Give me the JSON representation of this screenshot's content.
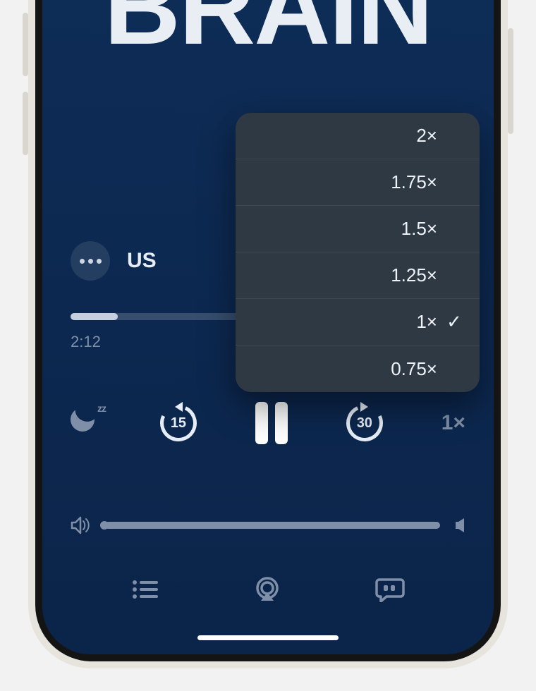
{
  "cover": {
    "title_text": "BRAIN"
  },
  "meta": {
    "more_button": "more",
    "episode_title_visible": "US"
  },
  "progress": {
    "elapsed_label": "2:12",
    "fill_percent": 12
  },
  "speed_menu": {
    "options": [
      {
        "label": "2×",
        "checked": false
      },
      {
        "label": "1.75×",
        "checked": false
      },
      {
        "label": "1.5×",
        "checked": false
      },
      {
        "label": "1.25×",
        "checked": false
      },
      {
        "label": "1×",
        "checked": true
      },
      {
        "label": "0.75×",
        "checked": false
      }
    ],
    "checkmark": "✓"
  },
  "transport": {
    "sleep_zz": "zz",
    "skip_back_seconds": "15",
    "skip_forward_seconds": "30",
    "speed_label": "1×"
  },
  "bottom_tabs": {
    "queue": "queue",
    "airplay": "airplay",
    "transcript": "transcript"
  }
}
